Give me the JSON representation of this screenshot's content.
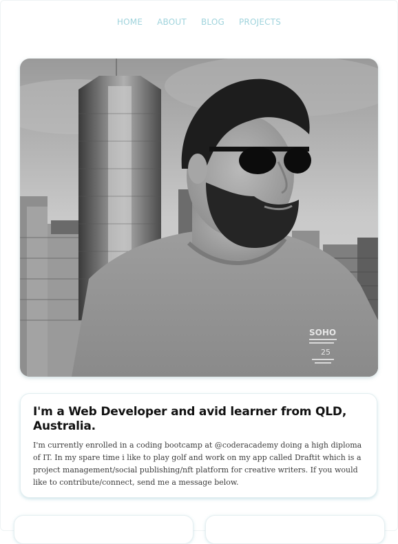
{
  "nav": {
    "items": [
      {
        "label": "HOME"
      },
      {
        "label": "ABOUT"
      },
      {
        "label": "BLOG"
      },
      {
        "label": "PROJECTS"
      }
    ]
  },
  "hero": {
    "image_subject": "portrait-photo-bw",
    "shirt_print": {
      "line1": "SOHO",
      "line2": "25"
    }
  },
  "intro": {
    "title": "I'm a Web Developer and avid learner from QLD, Australia.",
    "body": "I'm currently enrolled in a coding bootcamp at @coderacademy doing a high diploma of IT. In my spare time i like to play golf and work on my app called Draftit which is a project management/social publishing/nft platform for creative writers. If you would like to contribute/connect, send me a message below."
  },
  "colors": {
    "nav_link": "#9fd3dc",
    "card_shadow": "#96c8d2",
    "title_text": "#111111"
  }
}
